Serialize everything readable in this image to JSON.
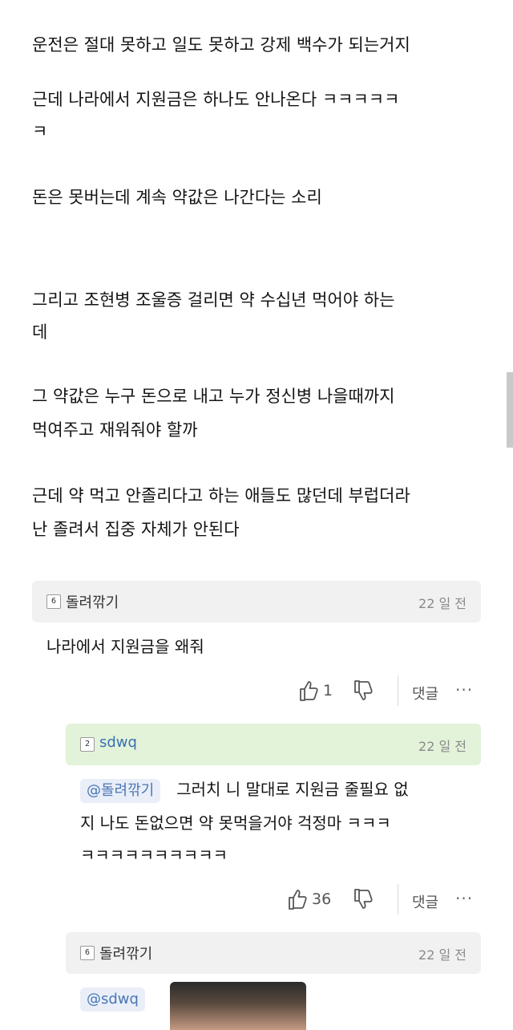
{
  "post": {
    "lines": [
      "운전은 절대 못하고 일도 못하고 강제 백수가 되는거지",
      "근데 나라에서 지원금은 하나도 안나온다 ㅋㅋㅋㅋㅋ",
      "ㅋ",
      "돈은 못버는데 계속 약값은 나간다는 소리",
      "그리고 조현병 조울증 걸리면 약 수십년 먹어야 하는",
      "데",
      "그 약값은 누구 돈으로 내고 누가 정신병 나을때까지",
      "먹여주고 재워줘야 할까",
      "근데 약 먹고 안졸리다고 하는 애들도 많던데 부럽더라",
      "난 졸려서 집중 자체가 안된다"
    ]
  },
  "comments": [
    {
      "level": "6",
      "author": "돌려깎기",
      "time": "22 일 전",
      "body": "나라에서 지원금을 왜줘",
      "likes": "1",
      "reply_label": "댓글",
      "more_label": "···"
    },
    {
      "level": "2",
      "author": "sdwq",
      "time": "22 일 전",
      "mention": "@돌려깎기",
      "body_lines": [
        "그러치 니 말대로 지원금 줄필요 없",
        "지 나도 돈없으면 약 못먹을거야 걱정마 ㅋㅋㅋ",
        "ㅋㅋㅋㅋㅋㅋㅋㅋㅋㅋ"
      ],
      "likes": "36",
      "reply_label": "댓글",
      "more_label": "···"
    },
    {
      "level": "6",
      "author": "돌려깎기",
      "time": "22 일 전",
      "mention": "@sdwq"
    }
  ],
  "icons": {
    "like": "thumbs-up-icon",
    "dislike": "thumbs-down-icon",
    "level": "level-badge-icon"
  },
  "colors": {
    "reply_header_green": "#e2f3d9",
    "comment_header_grey": "#f1f1f1",
    "mention_blue": "#4a76b5"
  }
}
